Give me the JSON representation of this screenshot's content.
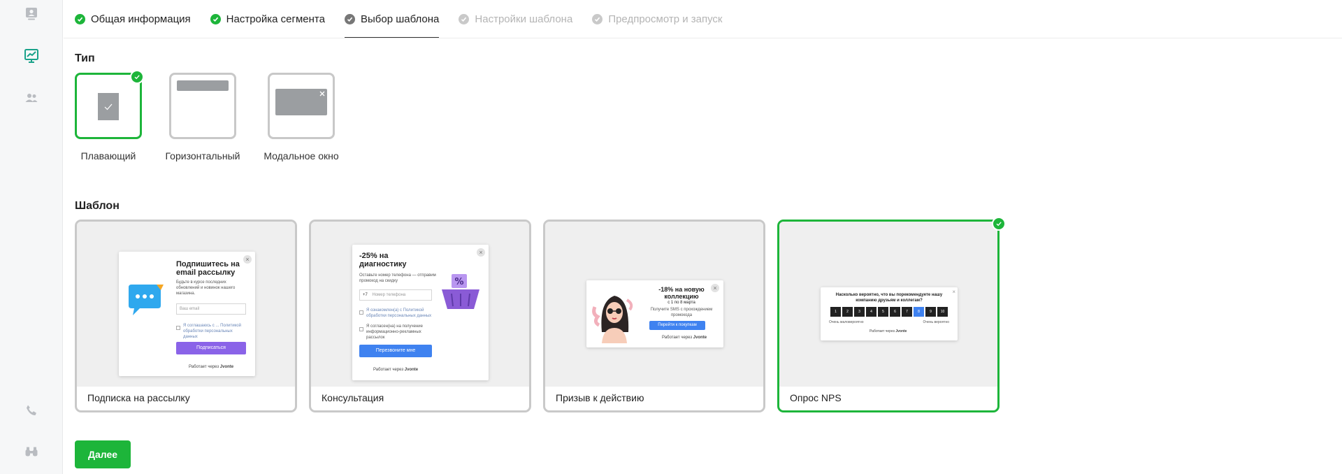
{
  "steps": [
    {
      "label": "Общая информация",
      "state": "done"
    },
    {
      "label": "Настройка сегмента",
      "state": "done"
    },
    {
      "label": "Выбор шаблона",
      "state": "active"
    },
    {
      "label": "Настройки шаблона",
      "state": "disabled"
    },
    {
      "label": "Предпросмотр и запуск",
      "state": "disabled"
    }
  ],
  "type_section": {
    "title": "Тип",
    "options": [
      {
        "label": "Плавающий",
        "selected": true
      },
      {
        "label": "Горизонтальный",
        "selected": false
      },
      {
        "label": "Модальное окно",
        "selected": false
      }
    ]
  },
  "template_section": {
    "title": "Шаблон",
    "templates": [
      {
        "name": "Подписка на рассылку",
        "selected": false,
        "preview": {
          "heading": "Подпишитесь на email рассылку",
          "text": "Будьте в курсе последних обновлений и новинок нашего магазина.",
          "placeholder": "Ваш email",
          "consent": "Я соглашаюсь с ... Политикой обработки персональных данных",
          "button": "Подписаться",
          "brand": "Работает через",
          "brand_logo": "Jvonte"
        }
      },
      {
        "name": "Консультация",
        "selected": false,
        "preview": {
          "heading": "-25% на диагностику",
          "text": "Оставьте номер телефона — отправим промокод на скидку",
          "prefix": "+7",
          "placeholder": "Номер телефона",
          "consent1": "Я ознакомлен(а) с Политикой обработки персональных данных",
          "consent2": "Я согласен(на) на получение информационно-рекламных рассылок",
          "button": "Перезвоните мне",
          "brand": "Работает через",
          "brand_logo": "Jvonte"
        }
      },
      {
        "name": "Призыв к действию",
        "selected": false,
        "preview": {
          "heading": "-18% на новую коллекцию",
          "subheading": "с 1 по 8 марта",
          "text": "Получите SMS с прохождением промокода",
          "button": "Перейти к покупкам",
          "brand": "Работает через",
          "brand_logo": "Jvonte"
        }
      },
      {
        "name": "Опрос NPS",
        "selected": true,
        "preview": {
          "heading": "Насколько вероятно, что вы порекомендуете нашу компанию друзьям и коллегам?",
          "scale": [
            "1",
            "2",
            "3",
            "4",
            "5",
            "6",
            "7",
            "8",
            "9",
            "10"
          ],
          "highlight_index": 7,
          "low_label": "Очень маловероятно",
          "high_label": "Очень вероятно",
          "brand": "Работает через",
          "brand_logo": "Jvonte"
        }
      }
    ]
  },
  "next_button": "Далее",
  "colors": {
    "accent": "#1db53a",
    "mini_button_purple": "#8a63e8",
    "mini_button_blue": "#3f82f0",
    "nps_cell": "#222222",
    "nps_highlight": "#3f82f0"
  }
}
